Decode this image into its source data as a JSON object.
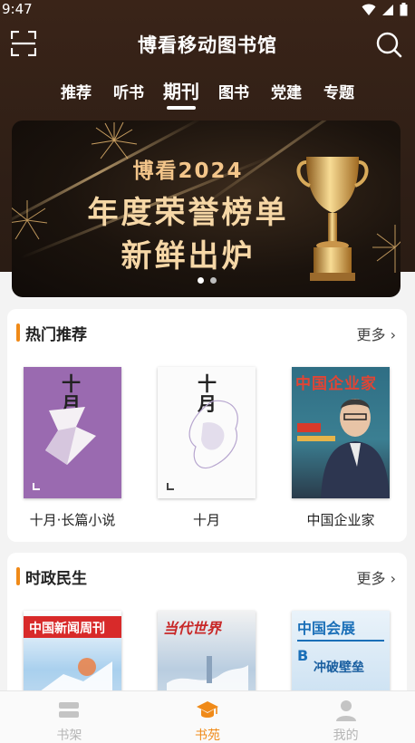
{
  "status": {
    "time": "9:47"
  },
  "header": {
    "title": "博看移动图书馆"
  },
  "tabs": [
    {
      "label": "推荐",
      "active": false
    },
    {
      "label": "听书",
      "active": false
    },
    {
      "label": "期刊",
      "active": true
    },
    {
      "label": "图书",
      "active": false
    },
    {
      "label": "党建",
      "active": false
    },
    {
      "label": "专题",
      "active": false
    }
  ],
  "banner": {
    "brand": "博看2024",
    "line1": "年度荣誉榜单",
    "line2": "新鲜出炉",
    "slide_count": 2,
    "active_slide": 1
  },
  "hot": {
    "title": "热门推荐",
    "more": "更多",
    "books": [
      {
        "name": "十月·长篇小说",
        "cover_title": "十月"
      },
      {
        "name": "十月",
        "cover_title": "十月"
      },
      {
        "name": "中国企业家",
        "cover_title": "中国企业家"
      }
    ]
  },
  "politics": {
    "title": "时政民生",
    "more": "更多",
    "books": [
      {
        "cover_title": "中国新闻周刊"
      },
      {
        "cover_title": "当代世界"
      },
      {
        "cover_title": "中国会展",
        "cover_sub": "冲破壁垒"
      }
    ]
  },
  "nav": [
    {
      "label": "书架",
      "icon": "bookshelf-icon",
      "active": false
    },
    {
      "label": "书苑",
      "icon": "graduation-cap-icon",
      "active": true
    },
    {
      "label": "我的",
      "icon": "user-icon",
      "active": false
    }
  ],
  "colors": {
    "accent": "#f08a18",
    "header_bg": "#2f1f16"
  }
}
